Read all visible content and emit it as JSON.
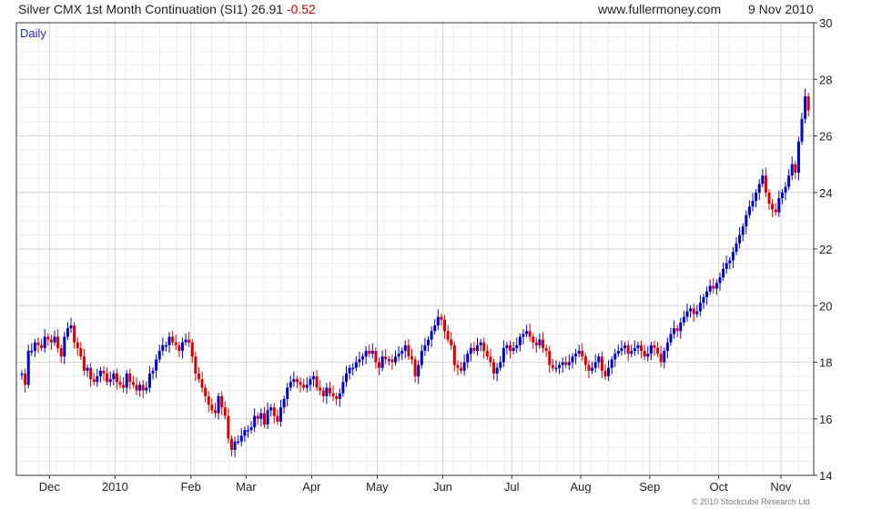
{
  "header": {
    "title_prefix": "Silver CMX 1st Month Continuation (SI1) 26.91",
    "change": "-0.52",
    "site": "www.fullermoney.com",
    "date": "9 Nov 2010"
  },
  "period_label": "Daily",
  "copyright": "© 2010 Stockcube Research Ltd",
  "colors": {
    "up": "#0000cc",
    "down": "#dd0000",
    "grid": "#d4d4d4"
  },
  "chart_data": {
    "type": "ohlc",
    "period": "Daily",
    "ylim": [
      14,
      30
    ],
    "y_ticks": [
      14,
      16,
      18,
      20,
      22,
      24,
      26,
      28,
      30
    ],
    "y_axis_position": "right",
    "grid": true,
    "x_labels": [
      "Dec",
      "2010",
      "Feb",
      "Mar",
      "Apr",
      "May",
      "Jun",
      "Jul",
      "Aug",
      "Sep",
      "Oct",
      "Nov"
    ],
    "x_label_days": [
      8,
      27,
      49,
      65,
      84,
      103,
      122,
      142,
      162,
      182,
      202,
      220
    ],
    "total_days": 229,
    "closes": [
      17.6,
      17.2,
      18.4,
      18.4,
      18.7,
      18.6,
      18.5,
      18.9,
      18.8,
      18.7,
      18.9,
      18.5,
      18.2,
      18.9,
      19.2,
      19.3,
      18.7,
      18.5,
      18.2,
      17.7,
      17.8,
      17.4,
      17.3,
      17.5,
      17.7,
      17.6,
      17.3,
      17.4,
      17.6,
      17.3,
      17.2,
      17.1,
      17.6,
      17.3,
      17.2,
      17.0,
      17.2,
      17.0,
      17.1,
      17.6,
      17.7,
      18.1,
      18.4,
      18.6,
      18.6,
      18.9,
      18.7,
      18.6,
      18.4,
      18.7,
      18.8,
      18.7,
      18.2,
      17.6,
      17.4,
      17.1,
      16.8,
      16.5,
      16.3,
      16.2,
      16.8,
      16.4,
      16.1,
      15.3,
      14.9,
      15.2,
      15.2,
      15.4,
      15.6,
      15.6,
      15.7,
      16.1,
      16.0,
      16.2,
      15.8,
      16.3,
      16.4,
      16.1,
      15.9,
      16.4,
      16.7,
      17.1,
      17.3,
      17.4,
      17.3,
      17.2,
      17.1,
      17.2,
      17.4,
      17.5,
      17.1,
      17.0,
      16.8,
      17.1,
      16.9,
      16.8,
      16.7,
      16.9,
      17.3,
      17.6,
      17.8,
      17.8,
      18.0,
      18.1,
      18.2,
      18.4,
      18.3,
      18.4,
      18.0,
      17.8,
      18.2,
      18.1,
      18.1,
      18.0,
      18.2,
      18.3,
      18.4,
      18.6,
      18.2,
      18.1,
      17.5,
      17.9,
      18.4,
      18.6,
      18.8,
      19.1,
      19.3,
      19.6,
      19.5,
      19.1,
      18.8,
      18.6,
      17.9,
      17.8,
      17.7,
      18.0,
      18.3,
      18.5,
      18.4,
      18.6,
      18.7,
      18.4,
      18.2,
      18.0,
      17.6,
      17.8,
      18.0,
      18.5,
      18.6,
      18.4,
      18.5,
      18.6,
      18.9,
      19.0,
      19.1,
      18.9,
      18.7,
      18.6,
      18.8,
      18.5,
      18.4,
      17.9,
      17.8,
      17.8,
      17.9,
      18.0,
      17.9,
      18.0,
      18.2,
      18.3,
      18.4,
      18.2,
      17.9,
      17.7,
      17.8,
      18.0,
      18.2,
      17.7,
      17.5,
      17.8,
      18.1,
      18.3,
      18.4,
      18.5,
      18.6,
      18.3,
      18.4,
      18.5,
      18.6,
      18.4,
      18.2,
      18.3,
      18.6,
      18.5,
      18.3,
      18.0,
      18.4,
      18.7,
      19.0,
      19.2,
      19.1,
      19.4,
      19.6,
      19.8,
      19.9,
      19.7,
      19.8,
      20.1,
      20.3,
      20.5,
      20.7,
      20.6,
      20.8,
      21.0,
      21.3,
      21.5,
      21.6,
      21.9,
      22.2,
      22.5,
      22.8,
      23.2,
      23.5,
      23.7,
      24.0,
      24.3,
      24.6,
      24.0,
      23.6,
      23.4,
      23.3,
      23.8,
      24.0,
      24.2,
      24.6,
      25.0,
      24.7,
      25.8,
      26.6,
      27.4,
      26.9
    ]
  }
}
